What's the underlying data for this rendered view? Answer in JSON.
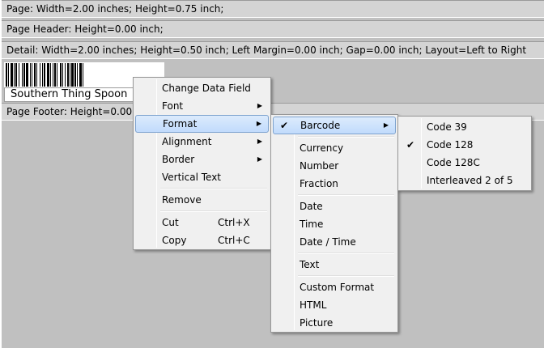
{
  "bands": {
    "page": "Page: Width=2.00 inches; Height=0.75 inch;",
    "header": "Page Header: Height=0.00 inch;",
    "detail": "Detail: Width=2.00 inches; Height=0.50 inch; Left Margin=0.00 inch; Gap=0.00 inch; Layout=Left to Right",
    "footer": "Page Footer: Height=0.00 inc"
  },
  "barcode_text": "Southern Thing Spoon",
  "context_menu": {
    "items": [
      {
        "label": "Change Data Field"
      },
      {
        "label": "Font"
      },
      {
        "label": "Format"
      },
      {
        "label": "Alignment"
      },
      {
        "label": "Border"
      },
      {
        "label": "Vertical Text"
      },
      {
        "label": "Remove"
      },
      {
        "label": "Cut",
        "shortcut": "Ctrl+X"
      },
      {
        "label": "Copy",
        "shortcut": "Ctrl+C"
      }
    ]
  },
  "format_menu": {
    "items": [
      {
        "label": "Barcode"
      },
      {
        "label": "Currency"
      },
      {
        "label": "Number"
      },
      {
        "label": "Fraction"
      },
      {
        "label": "Date"
      },
      {
        "label": "Time"
      },
      {
        "label": "Date / Time"
      },
      {
        "label": "Text"
      },
      {
        "label": "Custom Format"
      },
      {
        "label": "HTML"
      },
      {
        "label": "Picture"
      }
    ]
  },
  "barcode_menu": {
    "items": [
      {
        "label": "Code 39"
      },
      {
        "label": "Code 128"
      },
      {
        "label": "Code 128C"
      },
      {
        "label": "Interleaved 2 of 5"
      }
    ]
  },
  "glyphs": {
    "arrow": "▶",
    "check": "✔"
  }
}
